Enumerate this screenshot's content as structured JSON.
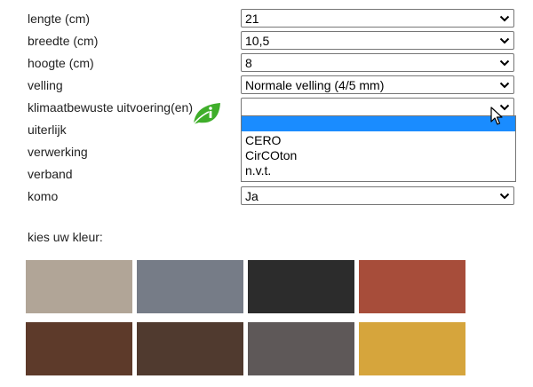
{
  "form": {
    "rows": [
      {
        "label": "lengte (cm)",
        "value": "21",
        "has_select": true
      },
      {
        "label": "breedte (cm)",
        "value": "10,5",
        "has_select": true
      },
      {
        "label": "hoogte (cm)",
        "value": "8",
        "has_select": true
      },
      {
        "label": "velling",
        "value": "Normale velling (4/5 mm)",
        "has_select": true
      },
      {
        "label": "klimaatbewuste uitvoering(en)",
        "value": "",
        "has_select": true
      },
      {
        "label": "uiterlijk",
        "value": "",
        "has_select": false
      },
      {
        "label": "verwerking",
        "value": "",
        "has_select": false
      },
      {
        "label": "verband",
        "value": "",
        "has_select": false
      },
      {
        "label": "komo",
        "value": "Ja",
        "has_select": true
      }
    ],
    "open_dropdown": {
      "options": [
        "",
        "CERO",
        "CirCOton",
        "n.v.t."
      ],
      "highlighted_index": 0
    }
  },
  "icons": {
    "leaf_info": "leaf-info-icon",
    "chevron": "chevron-down-icon",
    "cursor": "mouse-pointer-icon"
  },
  "colors_section": {
    "label": "kies uw kleur:",
    "swatches": [
      {
        "name": "beige",
        "color": "#b1a597"
      },
      {
        "name": "grey",
        "color": "#767c87"
      },
      {
        "name": "black",
        "color": "#2c2c2c"
      },
      {
        "name": "red",
        "color": "#a74d3a"
      },
      {
        "name": "brown",
        "color": "#5d3a2a"
      },
      {
        "name": "dark-brown",
        "color": "#503a2f"
      },
      {
        "name": "dark-grey",
        "color": "#5e5858"
      },
      {
        "name": "yellow",
        "color": "#d6a53c"
      }
    ]
  },
  "accent": {
    "highlight": "#1a8cff",
    "leaf_green": "#3fae2a"
  }
}
